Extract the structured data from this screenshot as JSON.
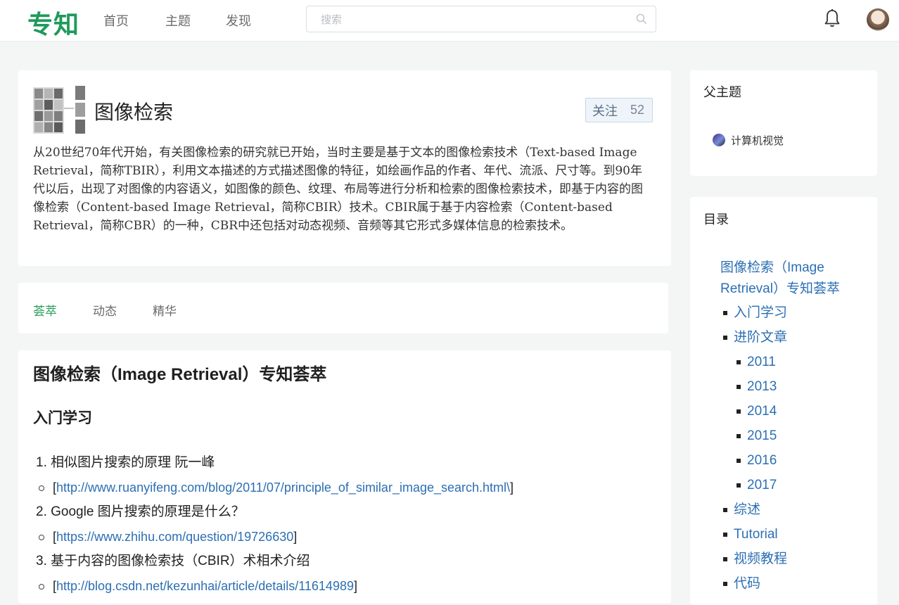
{
  "nav": {
    "logo": "专知",
    "items": [
      "首页",
      "主题",
      "发现"
    ],
    "search_placeholder": "搜索"
  },
  "topic": {
    "title": "图像检索",
    "follow_label": "关注",
    "follow_count": "52",
    "description": "从20世纪70年代开始，有关图像检索的研究就已开始，当时主要是基于文本的图像检索技术（Text-based Image Retrieval，简称TBIR），利用文本描述的方式描述图像的特征，如绘画作品的作者、年代、流派、尺寸等。到90年代以后，出现了对图像的内容语义，如图像的颜色、纹理、布局等进行分析和检索的图像检索技术，即基于内容的图像检索（Content-based Image Retrieval，简称CBIR）技术。CBIR属于基于内容检索（Content-based Retrieval，简称CBR）的一种，CBR中还包括对动态视频、音频等其它形式多媒体信息的检索技术。"
  },
  "tabs": [
    "荟萃",
    "动态",
    "精华"
  ],
  "content": {
    "title": "图像检索（Image Retrieval）专知荟萃",
    "section": "入门学习",
    "items": [
      {
        "num": "1.",
        "text": "相似图片搜索的原理 阮一峰",
        "link": "http://www.ruanyifeng.com/blog/2011/07/principle_of_similar_image_search.html\\"
      },
      {
        "num": "2.",
        "text": "Google 图片搜索的原理是什么？",
        "link": "https://www.zhihu.com/question/19726630"
      },
      {
        "num": "3.",
        "text": "基于内容的图像检索技（CBIR）术相术介绍",
        "link": "http://blog.csdn.net/kezunhai/article/details/11614989"
      }
    ]
  },
  "sidebar": {
    "parent_title": "父主题",
    "parent_topic": "计算机视觉",
    "toc_title": "目录",
    "toc_root": "图像检索（Image Retrieval）专知荟萃",
    "toc": [
      {
        "label": "入门学习",
        "level": 1
      },
      {
        "label": "进阶文章",
        "level": 1
      },
      {
        "label": "2011",
        "level": 2
      },
      {
        "label": "2013",
        "level": 2
      },
      {
        "label": "2014",
        "level": 2
      },
      {
        "label": "2015",
        "level": 2
      },
      {
        "label": "2016",
        "level": 2
      },
      {
        "label": "2017",
        "level": 2
      },
      {
        "label": "综述",
        "level": 1
      },
      {
        "label": "Tutorial",
        "level": 1
      },
      {
        "label": "视频教程",
        "level": 1
      },
      {
        "label": "代码",
        "level": 1
      }
    ]
  },
  "colors": {
    "brand": "#1e9a5b",
    "link": "#2c6fb3",
    "tab_active": "#2a9d5c"
  }
}
